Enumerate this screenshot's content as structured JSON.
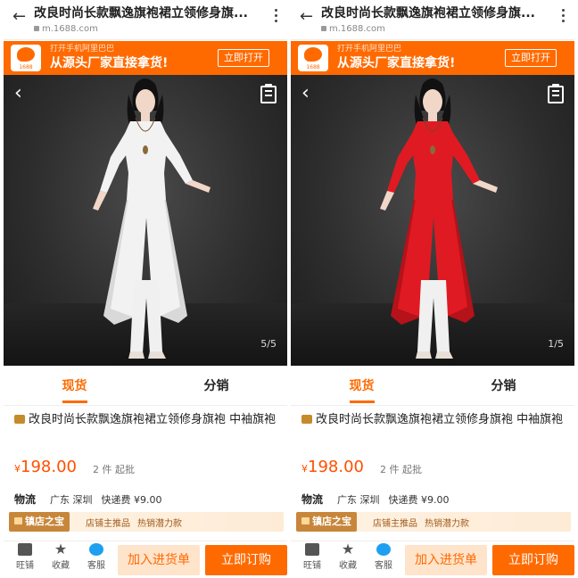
{
  "panels": [
    {
      "header": {
        "title": "改良时尚长款飘逸旗袍裙立领修身旗...",
        "url": "m.1688.com"
      },
      "banner": {
        "line1": "打开手机阿里巴巴",
        "line2": "从源头厂家直接拿货!",
        "open_label": "立即打开",
        "logo_text": "1688"
      },
      "photo": {
        "dress_color": "#f2f2f2",
        "dress_shade": "#d9d9d9",
        "pants_color": "#f0f0f0",
        "counter": "5/5"
      },
      "tabs": {
        "stock": "现货",
        "distribution": "分销"
      },
      "product": {
        "title": "改良时尚长款飘逸旗袍裙立领修身旗袍 中袖旗袍",
        "price_currency": "¥",
        "price_value": "198.00",
        "moq": "2 件 起批"
      },
      "logistics": {
        "label": "物流",
        "origin": "广东 深圳",
        "fee": "快递费 ¥9.00"
      },
      "store": {
        "badge": "镇店之宝",
        "tag1": "店铺主推品",
        "tag2": "热销潜力款"
      },
      "bottom": {
        "shop": "旺铺",
        "favorite": "收藏",
        "service": "客服",
        "add_cart": "加入进货单",
        "buy_now": "立即订购"
      }
    },
    {
      "header": {
        "title": "改良时尚长款飘逸旗袍裙立领修身旗...",
        "url": "m.1688.com"
      },
      "banner": {
        "line1": "打开手机阿里巴巴",
        "line2": "从源头厂家直接拿货!",
        "open_label": "立即打开",
        "logo_text": "1688"
      },
      "photo": {
        "dress_color": "#e01a22",
        "dress_shade": "#b5121a",
        "pants_color": "#f0f0f0",
        "counter": "1/5"
      },
      "tabs": {
        "stock": "现货",
        "distribution": "分销"
      },
      "product": {
        "title": "改良时尚长款飘逸旗袍裙立领修身旗袍 中袖旗袍",
        "price_currency": "¥",
        "price_value": "198.00",
        "moq": "2 件 起批"
      },
      "logistics": {
        "label": "物流",
        "origin": "广东 深圳",
        "fee": "快递费 ¥9.00"
      },
      "store": {
        "badge": "镇店之宝",
        "tag1": "店铺主推品",
        "tag2": "热销潜力款"
      },
      "bottom": {
        "shop": "旺铺",
        "favorite": "收藏",
        "service": "客服",
        "add_cart": "加入进货单",
        "buy_now": "立即订购"
      }
    }
  ],
  "colors": {
    "brand": "#ff6a00",
    "price": "#ff5000",
    "store_badge": "#c8863a"
  }
}
